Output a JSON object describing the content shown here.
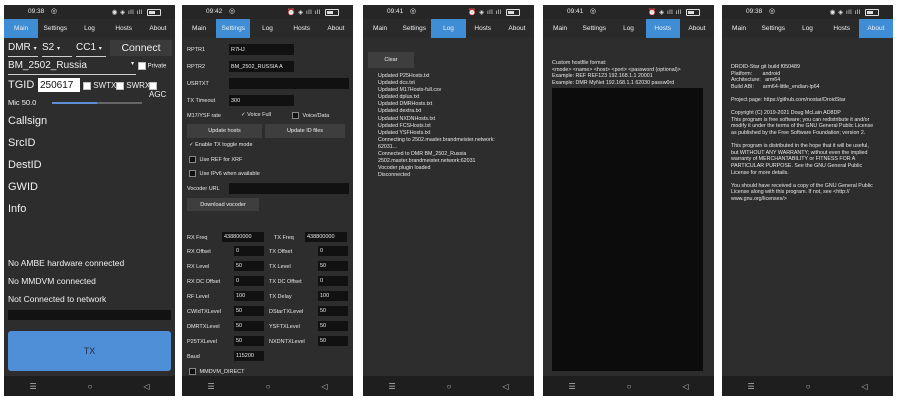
{
  "tabs": [
    "Main",
    "Settings",
    "Log",
    "Hosts",
    "About"
  ],
  "screens": [
    {
      "time": "09:38",
      "active_tab": 0
    },
    {
      "time": "09:42",
      "active_tab": 1
    },
    {
      "time": "09:41",
      "active_tab": 2
    },
    {
      "time": "09:41",
      "active_tab": 3
    },
    {
      "time": "09:38",
      "active_tab": 4
    }
  ],
  "main": {
    "mode": "DMR",
    "slot": "S2",
    "cc": "CC1",
    "connect_label": "Connect",
    "host": "BM_2502_Russia",
    "private_label": "Private",
    "tgid_label": "TGID",
    "tgid_value": "250617",
    "swtx_label": "SWTX",
    "swrx_label": "SWRX",
    "agc_label": "AGC",
    "mic_label": "Mic 50.0",
    "mic_level": 0.5,
    "callsign_label": "Callsign",
    "srcid_label": "SrcID",
    "destid_label": "DestID",
    "gwid_label": "GWID",
    "info_label": "Info",
    "status1": "No AMBE hardware connected",
    "status2": "No MMDVM connected",
    "status3": "Not Connected to network",
    "tx_label": "TX"
  },
  "settings": {
    "rptr1_label": "RPTR1",
    "rptr1_value": "R7HJ",
    "rptr2_label": "RPTR2",
    "rptr2_value": "BM_2502_RUSSIA A",
    "usrtxt_label": "USRTXT",
    "usrtxt_value": "",
    "txtimeout_label": "TX Timeout",
    "txtimeout_value": "300",
    "m17ysf_label": "M17/YSF rate",
    "voice_full_label": "Voice Full",
    "voice_data_label": "Voice/Data",
    "update_hosts_label": "Update hosts",
    "update_id_label": "Update ID files",
    "enable_tx_toggle_label": "Enable TX toggle mode",
    "use_ref_label": "Use REF for XRF",
    "use_ipv6_label": "Use IPv6 when available",
    "vocoder_url_label": "Vocoder URL",
    "vocoder_url_value": "",
    "download_vocoder_label": "Download vocoder",
    "rxfreq_label": "RX Freq",
    "rxfreq_value": "438800000",
    "txfreq_label": "TX Freq",
    "txfreq_value": "438800000",
    "rxoffset_label": "RX Offset",
    "rxoffset_value": "0",
    "txoffset_label": "TX Offset",
    "txoffset_value": "0",
    "rxlevel_label": "RX Level",
    "rxlevel_value": "50",
    "txlevel_label": "TX Level",
    "txlevel_value": "50",
    "rxdcoffset_label": "RX DC Offset",
    "rxdcoffset_value": "0",
    "txdcoffset_label": "TX DC Offset",
    "txdcoffset_value": "0",
    "rflevel_label": "RF Level",
    "rflevel_value": "100",
    "txdelay_label": "TX Delay",
    "txdelay_value": "100",
    "cwidtxlevel_label": "CWIdTXLevel",
    "cwidtxlevel_value": "50",
    "dstartxlevel_label": "DStarTXLevel",
    "dstartxlevel_value": "50",
    "dmrtxlevel_label": "DMRTXLevel",
    "dmrtxlevel_value": "50",
    "ysftxlevel_label": "YSFTXLevel",
    "ysftxlevel_value": "50",
    "p25txlevel_label": "P25TXLevel",
    "p25txlevel_value": "50",
    "nxdntxlevel_label": "NXDNTXLevel",
    "nxdntxlevel_value": "50",
    "baud_label": "Baud",
    "baud_value": "115200",
    "mmdvm_direct_label": "MMDVM_DIRECT"
  },
  "log": {
    "clear_label": "Clear",
    "lines": "Updated P25Hosts.txt\nUpdated dcs.txt\nUpdated M17Hosts-full.csv\nUpdated dplus.txt\nUpdated DMRHosts.txt\nUpdated dextra.txt\nUpdated NXDNHosts.txt\nUpdated FCSHosts.txt\nUpdated YSFHosts.txt\nConnecting to 2502.master.brandmeister.network:\n62031...\nConnected to DMR BM_2502_Russia\n2502.master.brandmeister.network:62031\nVocoder plugin loaded\nDisconnected"
  },
  "hosts": {
    "text": "Custom hostfile format:\n<mode> <name> <host> <port> <password (optional)>\nExample: REF REF123 192.168.1.1 20001\nExample: DMR MyNet 192.168.1.1 62030 passw0rd"
  },
  "about": {
    "text": "DROID-Star git build f050489\nPlatform:       android\nArchitecture:   arm64\nBuild ABI:      arm64-little_endian-lp64\n\nProject page: https://github.com/nostar/DroidStar\n\nCopyright (C) 2019-2021 Doug McLain AD8DP\nThis program is free software; you can redistribute it and/or\nmodify it under the terms of the GNU General Public License\nas published by the Free Software Foundation; version 2.\n\nThis program is distributed in the hope that it will be useful,\nbut WITHOUT ANY WARRANTY; without even the implied\nwarranty of MERCHANTABILITY or FITNESS FOR A\nPARTICULAR PURPOSE. See the GNU General Public\nLicense for more details.\n\nYou should have received a copy of the GNU General Public\nLicense along with this program. If not, see <http://\nwww.gnu.org/licenses/>"
  },
  "colors": {
    "accent": "#3f8dd5",
    "background": "#2d2d2d",
    "field": "#111111"
  }
}
